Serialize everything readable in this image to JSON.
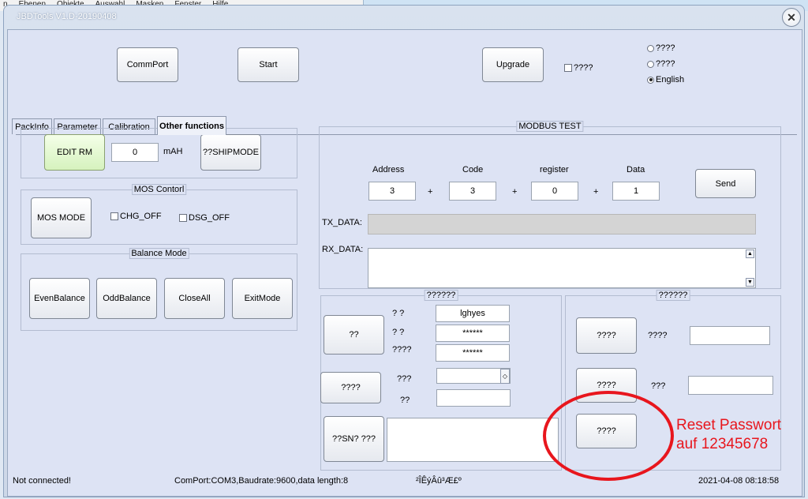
{
  "background": {
    "menu": [
      "n",
      "Ebenen",
      "Objekte",
      "Auswahl",
      "Masken",
      "Fenster",
      "Hilfe"
    ]
  },
  "window": {
    "title": "JBDTools V1.D-20190408"
  },
  "toolbar": {
    "commport": "CommPort",
    "start": "Start",
    "upgrade": "Upgrade",
    "checkbox_label": "????",
    "lang_options": [
      "????",
      "????",
      "English"
    ]
  },
  "tabs": [
    "PackInfo",
    "Parameter",
    "Calibration",
    "Other functions"
  ],
  "rm": {
    "edit_button": "EDIT RM",
    "value": "0",
    "unit": "mAH",
    "shipmode_button": "??SHIPMODE"
  },
  "mos": {
    "title": "MOS Contorl",
    "button": "MOS MODE",
    "chg": "CHG_OFF",
    "dsg": "DSG_OFF"
  },
  "balance": {
    "title": "Balance Mode",
    "buttons": [
      "EvenBalance",
      "OddBalance",
      "CloseAll",
      "ExitMode"
    ]
  },
  "modbus": {
    "title": "MODBUS TEST",
    "headers": [
      "Address",
      "Code",
      "register",
      "Data"
    ],
    "values": [
      "3",
      "3",
      "0",
      "1"
    ],
    "plus": "+",
    "send": "Send",
    "tx_label": "TX_DATA:",
    "rx_label": "RX_DATA:"
  },
  "left_panel": {
    "title": "??????",
    "button1": "??",
    "row_labels": [
      "?    ?",
      "?    ?",
      "????"
    ],
    "row_values": [
      "lghyes",
      "******",
      "******"
    ],
    "button2": "????",
    "label_a": "???",
    "label_b": "??",
    "button3": "??SN?    ???"
  },
  "right_panel": {
    "title": "??????",
    "button1": "????",
    "label1": "????",
    "button2": "????",
    "label2": "???",
    "button3": "????"
  },
  "status": {
    "connection": "Not connected!",
    "port": "ComPort:COM3,Baudrate:9600,data length:8",
    "garbled": "²ÎÊýÂû³Æ£º",
    "datetime": "2021-04-08 08:18:58"
  },
  "annotation": {
    "line1": "Reset Passwort",
    "line2": "auf 12345678",
    "color": "#e8161d"
  }
}
